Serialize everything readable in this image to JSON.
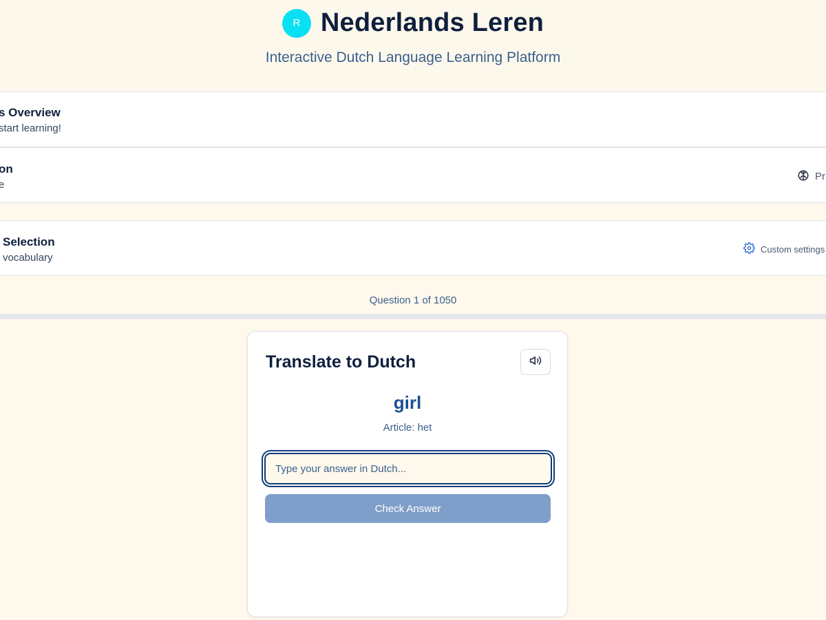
{
  "header": {
    "avatar_letter": "R",
    "title": "Nederlands Leren",
    "subtitle": "Interactive Dutch Language Learning Platform"
  },
  "panels": {
    "progress": {
      "title": "s Overview",
      "subtitle": "start learning!"
    },
    "mode": {
      "title": "on",
      "subtitle": "e",
      "action_icon": "brain-icon",
      "action_label": "Pr"
    },
    "selection": {
      "title": "Selection",
      "subtitle": "vocabulary",
      "action_icon": "gear-icon",
      "action_label": "Custom settings"
    }
  },
  "quiz": {
    "counter": "Question 1 of 1050",
    "card_title": "Translate to Dutch",
    "audio_icon": "speaker-icon",
    "word": "girl",
    "article": "Article: het",
    "input_value": "",
    "input_placeholder": "Type your answer in Dutch...",
    "check_label": "Check Answer"
  },
  "colors": {
    "background": "#fef9ec",
    "avatar": "#0ae0f4",
    "accent": "#1b4f93",
    "button_disabled": "#7f9fca",
    "icon_blue": "#2f6fd6"
  }
}
